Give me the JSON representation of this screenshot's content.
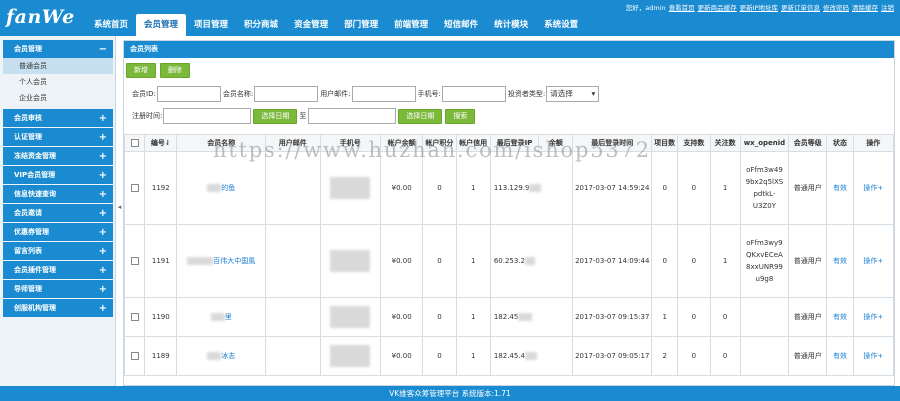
{
  "header": {
    "logo_text": "fanWe",
    "nav": [
      "系统首页",
      "会员管理",
      "项目管理",
      "积分商城",
      "资金管理",
      "部门管理",
      "前端管理",
      "短信邮件",
      "统计模块",
      "系统设置"
    ],
    "user_greeting": "您好，admin",
    "links": [
      "查看首页",
      "更新商品缓存",
      "更新IP地址库",
      "更新订单信息",
      "修改密码",
      "清除缓存",
      "注销"
    ]
  },
  "sidebar": {
    "groups": [
      {
        "label": "会员管理",
        "sign": "−",
        "subs": [
          {
            "label": "普通会员",
            "active": true
          },
          {
            "label": "个人会员",
            "active": false
          },
          {
            "label": "企业会员",
            "active": false
          }
        ]
      },
      {
        "label": "会员审核",
        "sign": "+"
      },
      {
        "label": "认证管理",
        "sign": "+"
      },
      {
        "label": "冻结资金管理",
        "sign": "+"
      },
      {
        "label": "VIP会员管理",
        "sign": "+"
      },
      {
        "label": "信息快速查询",
        "sign": "+"
      },
      {
        "label": "会员邀请",
        "sign": "+"
      },
      {
        "label": "优惠券管理",
        "sign": "+"
      },
      {
        "label": "留言列表",
        "sign": "+"
      },
      {
        "label": "会员插件管理",
        "sign": "+"
      },
      {
        "label": "导师管理",
        "sign": "+"
      },
      {
        "label": "创服机构管理",
        "sign": "+"
      }
    ]
  },
  "main": {
    "panel_title": "会员列表",
    "toolbar": {
      "add_label": "新增",
      "delete_label": "删除"
    },
    "filters": {
      "member_id_label": "会员ID:",
      "member_name_label": "会员名称:",
      "email_label": "用户邮件:",
      "mobile_label": "手机号:",
      "investor_type_label": "投资者类型:",
      "investor_type_value": "请选择",
      "reg_time_label": "注册时间:",
      "select_date_label": "选择日期",
      "to_label": "至",
      "search_label": "搜索"
    },
    "table": {
      "columns": [
        "编号",
        "会员名称",
        "用户邮件",
        "手机号",
        "帐户余额",
        "帐户积分",
        "帐户信用",
        "最后登录IP",
        "余额",
        "最后登录时间",
        "项目数",
        "支持数",
        "关注数",
        "wx_openid",
        "会员等级",
        "状态",
        "操作"
      ],
      "rows": [
        {
          "id": "1192",
          "name": "的鱼",
          "balance": "¥0.00",
          "points": "0",
          "credit": "1",
          "ip": "113.129.9",
          "last_login": "2017-03-07 14:59:24",
          "projects": "0",
          "supports": "0",
          "follows": "1",
          "openid": [
            "oFfm3w49",
            "9bx2q5lXS",
            "pdtkL-",
            "U3Z0Y"
          ],
          "level": "普通用户",
          "status": "有效",
          "action": "操作"
        },
        {
          "id": "1191",
          "name": "百伟大中国風",
          "balance": "¥0.00",
          "points": "0",
          "credit": "1",
          "ip": "60.253.2",
          "last_login": "2017-03-07 14:09:44",
          "projects": "0",
          "supports": "0",
          "follows": "1",
          "openid": [
            "oFfm3wy9",
            "QKxvECeA",
            "8xxUNR99",
            "u9g8"
          ],
          "level": "普通用户",
          "status": "有效",
          "action": "操作"
        },
        {
          "id": "1190",
          "name": "里",
          "balance": "¥0.00",
          "points": "0",
          "credit": "1",
          "ip": "182.45",
          "last_login": "2017-03-07 09:15:37",
          "projects": "1",
          "supports": "0",
          "follows": "0",
          "openid": [],
          "level": "普通用户",
          "status": "有效",
          "action": "操作"
        },
        {
          "id": "1189",
          "name": "冰志",
          "balance": "¥0.00",
          "points": "0",
          "credit": "1",
          "ip": "182.45.4",
          "last_login": "2017-03-07 09:05:17",
          "projects": "2",
          "supports": "0",
          "follows": "0",
          "openid": [],
          "level": "普通用户",
          "status": "有效",
          "action": "操作"
        }
      ]
    }
  },
  "watermark": "https://www.huzhan.com/ishop5372",
  "footer": "VK维客众筹管理平台 系统版本:1.71",
  "colors": {
    "primary": "#1a8bd0",
    "green": "#7bb93a",
    "link": "#1a7ed6"
  }
}
